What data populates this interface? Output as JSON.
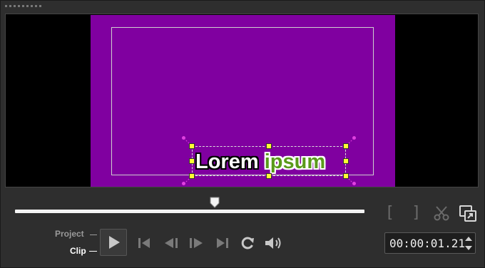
{
  "preview": {
    "background_color": "#000000",
    "canvas_color": "#8000a0",
    "title_words": [
      "Lorem",
      "ipsum"
    ],
    "title_colors": [
      "#ffffff",
      "#5a9a1a"
    ]
  },
  "playback": {
    "scrub_position_fraction": 0.57
  },
  "mode_switch": {
    "project_label": "Project",
    "clip_label": "Clip",
    "active": "Clip"
  },
  "buttons": {
    "mark_in_glyph": "[",
    "mark_out_glyph": "]"
  },
  "icons": [
    "grip-icon",
    "play-icon",
    "to-start-icon",
    "prev-frame-icon",
    "next-frame-icon",
    "to-end-icon",
    "repeat-icon",
    "volume-icon",
    "mark-in-icon",
    "mark-out-icon",
    "cut-icon",
    "enlarge-preview-icon",
    "timecode-up-icon",
    "timecode-down-icon"
  ],
  "timecode": {
    "value": "00:00:01.21"
  }
}
